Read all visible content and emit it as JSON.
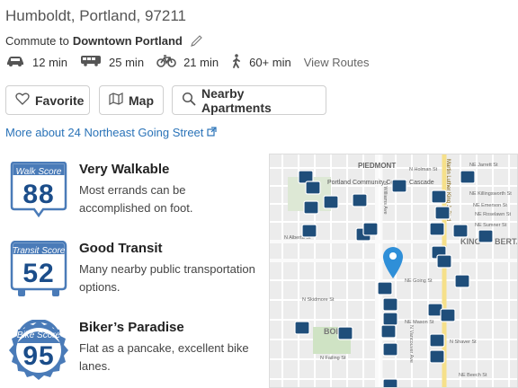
{
  "header": {
    "address": "Humboldt, Portland, 97211"
  },
  "commute": {
    "prefix": "Commute to",
    "destination": "Downtown Portland",
    "modes": [
      {
        "icon": "car-icon",
        "time": "12 min"
      },
      {
        "icon": "bus-icon",
        "time": "25 min"
      },
      {
        "icon": "bike-icon",
        "time": "21 min"
      },
      {
        "icon": "walk-icon",
        "time": "60+ min"
      }
    ],
    "view_routes": "View Routes"
  },
  "actions": {
    "favorite": "Favorite",
    "map": "Map",
    "nearby": "Nearby Apartments"
  },
  "more_link": "More about 24 Northeast Going Street",
  "scores": [
    {
      "badge_label": "Walk Score",
      "value": "88",
      "title": "Very Walkable",
      "description": "Most errands can be accomplished on foot."
    },
    {
      "badge_label": "Transit Score",
      "value": "52",
      "title": "Good Transit",
      "description": "Many nearby public transportation options."
    },
    {
      "badge_label": "Bike Score",
      "value": "95",
      "title": "Biker’s Paradise",
      "description": "Flat as a pancake, excellent bike lanes."
    }
  ],
  "map": {
    "labels": {
      "piedmont": "PIEDMONT",
      "college": "Portland Community College Cascade",
      "king": "KING",
      "alberta": "BERTA",
      "boise": "BOIS",
      "williams": "N Williams Ave",
      "albina": "N Albina Ave",
      "mlk": "Martin Luther King Jr Blvd",
      "vancouver": "N Vancouver Ave",
      "killingsworth": "NE Killingsworth St",
      "emerson": "NE Emerson St",
      "roselawn": "NE Roselawn St",
      "sumner": "NE Sumner St",
      "going": "NE Going St",
      "prescott": "NE Prescott St",
      "skidmore": "N Skidmore St",
      "alberta_st": "N Alberta St",
      "mason": "NE Mason St",
      "shaver": "N Shaver St",
      "failing": "N Failing St",
      "beech": "NE Beech St",
      "jarrett": "NE Jarrett St",
      "holman": "N Holman St"
    },
    "colors": {
      "pin": "#2f8fd8",
      "icon_dark": "#1f4e7a",
      "park": "#cfe3c4",
      "road_major": "#f6e08a"
    }
  }
}
